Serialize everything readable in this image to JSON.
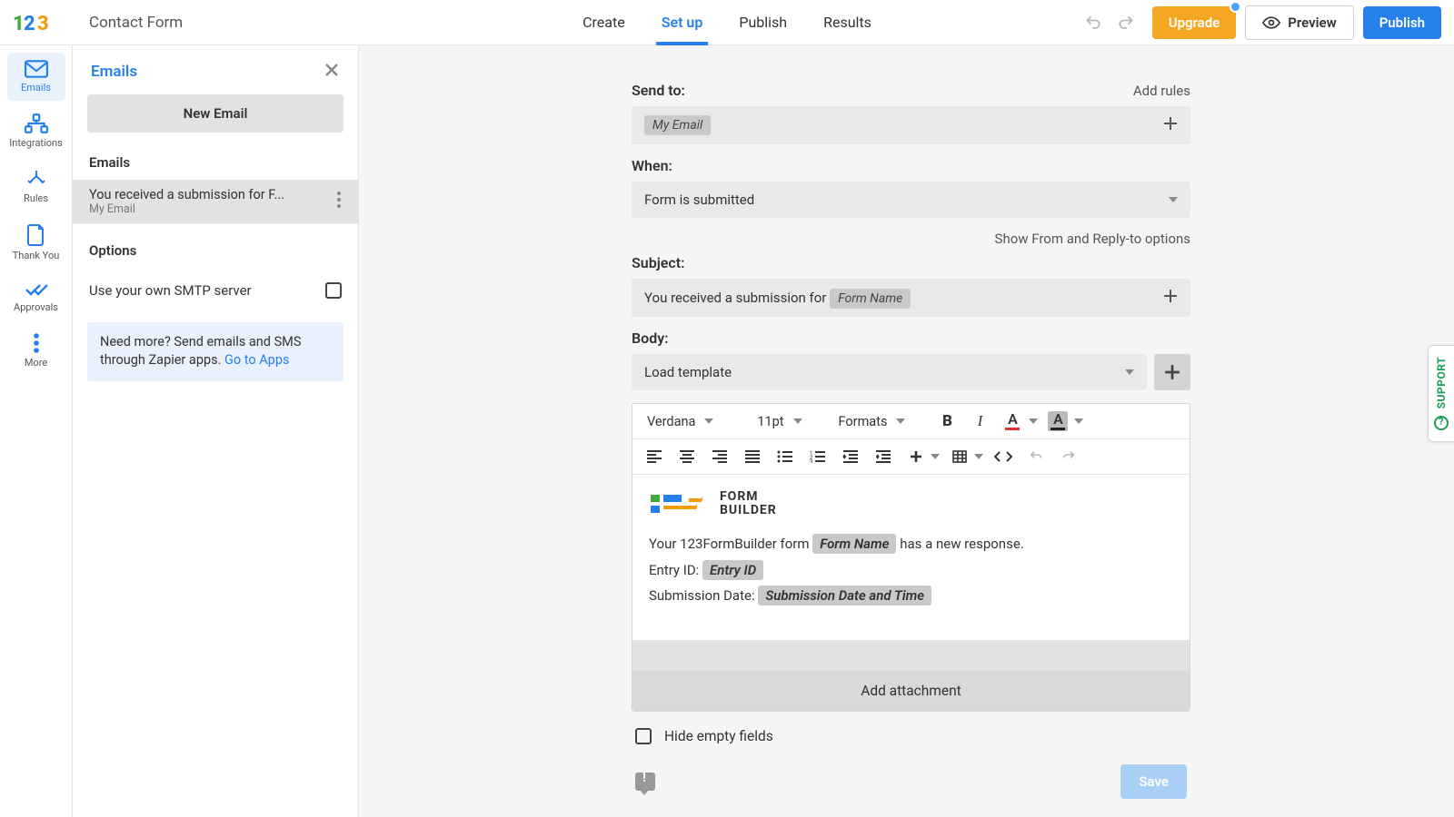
{
  "header": {
    "form_title": "Contact Form",
    "nav": {
      "create": "Create",
      "setup": "Set up",
      "publish": "Publish",
      "results": "Results"
    },
    "upgrade": "Upgrade",
    "preview": "Preview",
    "publish_btn": "Publish"
  },
  "rail": {
    "emails": "Emails",
    "integrations": "Integrations",
    "rules": "Rules",
    "thankyou": "Thank You",
    "approvals": "Approvals",
    "more": "More"
  },
  "panel": {
    "title": "Emails",
    "new_email": "New Email",
    "section_emails": "Emails",
    "item_title": "You received a submission for F...",
    "item_sub": "My Email",
    "section_options": "Options",
    "smtp": "Use your own SMTP server",
    "needmore1": "Need more? Send emails and SMS through Zapier apps. ",
    "needmore_link": "Go to Apps"
  },
  "main": {
    "sendto_label": "Send to:",
    "add_rules": "Add rules",
    "sendto_chip": "My Email",
    "when_label": "When:",
    "when_value": "Form is submitted",
    "show_from": "Show From and Reply-to options",
    "subject_label": "Subject:",
    "subject_prefix": "You received a submission for ",
    "subject_chip": "Form Name",
    "body_label": "Body:",
    "load_template": "Load template",
    "toolbar": {
      "font": "Verdana",
      "size": "11pt",
      "formats": "Formats"
    },
    "editor": {
      "logo_top": "FORM",
      "logo_bot": "BUILDER",
      "l1_pre": "Your 123FormBuilder form ",
      "l1_chip": "Form Name",
      "l1_post": " has a new response.",
      "l2_pre": "Entry ID: ",
      "l2_chip": "Entry ID",
      "l3_pre": "Submission Date: ",
      "l3_chip": "Submission Date and Time"
    },
    "add_attachment": "Add attachment",
    "hide_empty": "Hide empty fields",
    "save": "Save"
  },
  "support": "SUPPORT"
}
